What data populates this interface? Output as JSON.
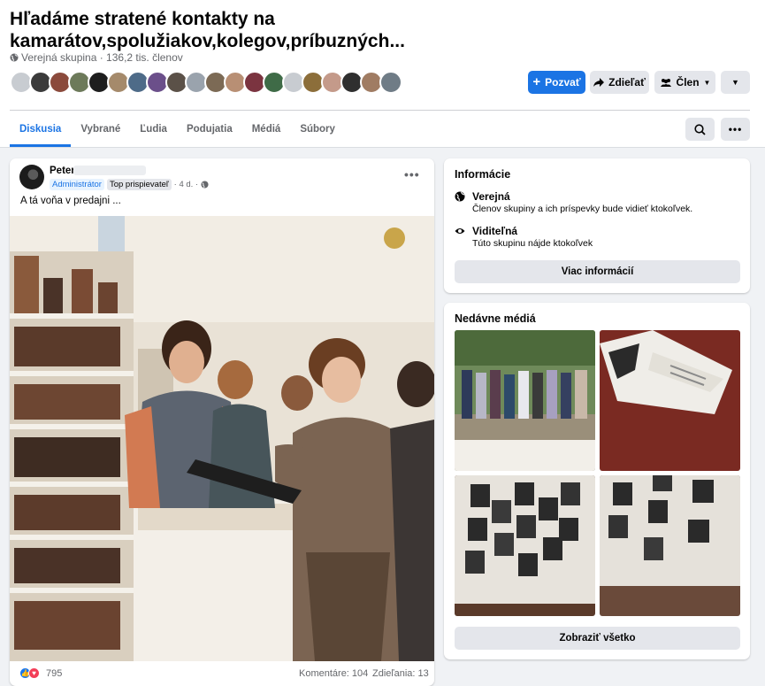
{
  "group": {
    "title": "Hľadáme stratené kontakty na kamarátov,spolužiakov,kolegov,príbuzných...",
    "meta": "Verejná skupina · 136,2 tis. členov"
  },
  "actions": {
    "invite": "Pozvať",
    "share": "Zdieľať",
    "member": "Člen"
  },
  "tabs": [
    "Diskusia",
    "Vybrané",
    "Ľudia",
    "Podujatia",
    "Médiá",
    "Súbory"
  ],
  "post": {
    "author": "Peter",
    "badge_admin": "Administrátor",
    "badge_top": "Top prispievateľ",
    "time": "· 4 d. ·",
    "text": "A tá voňa v predajni ...",
    "reactions": "795",
    "comments": "Komentáre: 104",
    "shares": "Zdieľania: 13"
  },
  "info": {
    "title": "Informácie",
    "public_title": "Verejná",
    "public_desc": "Členov skupiny a ich príspevky bude vidieť ktokoľvek.",
    "visible_title": "Viditeľná",
    "visible_desc": "Túto skupinu nájde ktokoľvek",
    "more_button": "Viac informácií"
  },
  "media": {
    "title": "Nedávne médiá",
    "show_all": "Zobraziť všetko"
  },
  "colors": {
    "accent": "#1b74e4",
    "background": "#f0f2f5",
    "like": "#1877f2",
    "love": "#f33e58"
  }
}
